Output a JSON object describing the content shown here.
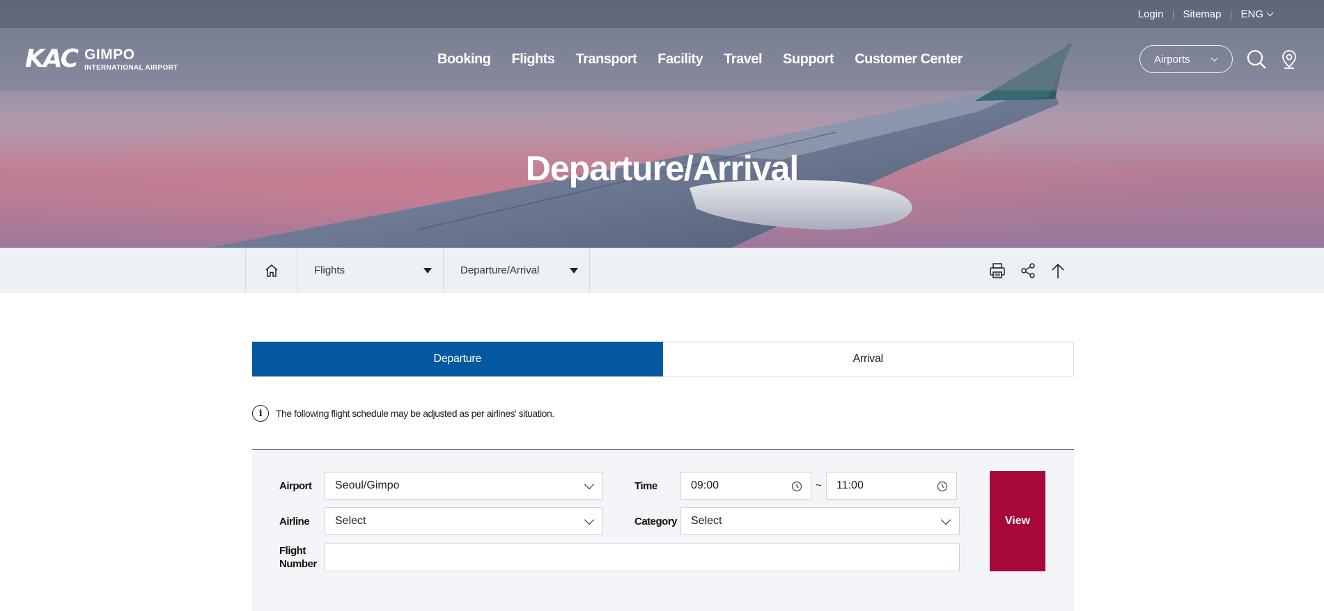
{
  "topbar": {
    "links": [
      "Login",
      "Sitemap",
      "ENG"
    ]
  },
  "logo": {
    "mark": "KAC",
    "name": "GIMPO",
    "subtitle": "INTERNATIONAL AIRPORT"
  },
  "mainnav": {
    "items": [
      "Booking",
      "Flights",
      "Transport",
      "Facility",
      "Travel",
      "Support",
      "Customer Center"
    ]
  },
  "airports_select": {
    "label": "Airports"
  },
  "hero": {
    "title": "Departure/Arrival"
  },
  "breadcrumb": {
    "level1": "Flights",
    "level2": "Departure/Arrival"
  },
  "tabs": [
    {
      "label": "Departure",
      "active": true
    },
    {
      "label": "Arrival",
      "active": false
    }
  ],
  "notice": {
    "icon": "info-icon",
    "text": "The following flight schedule may be adjusted as per airlines' situation."
  },
  "form": {
    "airport_label": "Airport",
    "airport_value": "Seoul/Gimpo",
    "time_label": "Time",
    "time_from": "09:00",
    "time_separator": "~",
    "time_to": "11:00",
    "airline_label": "Airline",
    "airline_value": "Select",
    "category_label": "Category",
    "category_value": "Select",
    "flight_label_1": "Flight",
    "flight_label_2": "Number",
    "flight_value": "",
    "view_button": "View"
  },
  "colors": {
    "tab_active": "#0458a2",
    "view_button": "#a8073a",
    "panel_bg": "#f3f5f8",
    "crumbbar_bg": "#edf0f4"
  }
}
